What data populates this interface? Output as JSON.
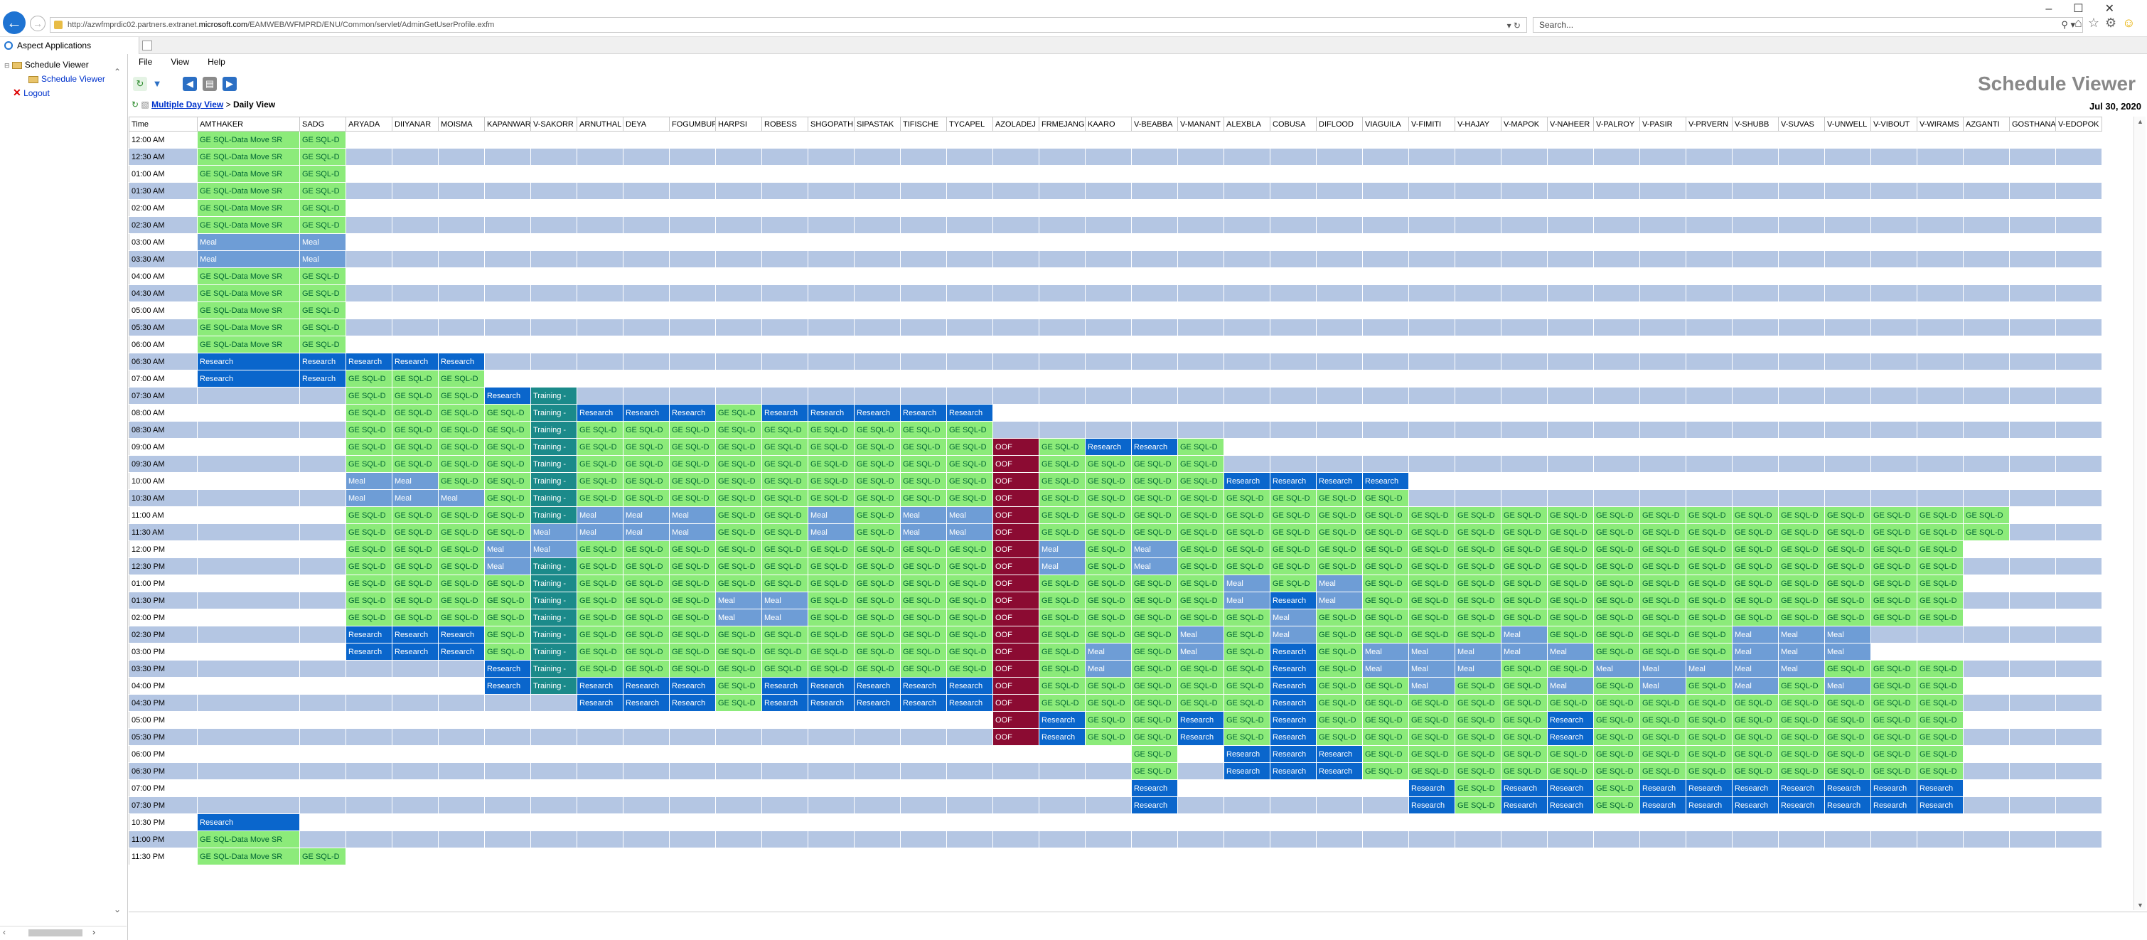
{
  "browser": {
    "url_prefix": "http://azwfmprdic02.partners.extranet.",
    "url_host": "microsoft.com",
    "url_path": "/EAMWEB/WFMPRD/ENU/Common/servlet/AdminGetUserProfile.exfm",
    "search_placeholder": "Search...",
    "tab_title": "Aspect Applications",
    "window_controls": "–☐✕"
  },
  "tree": {
    "root": "Schedule Viewer",
    "child": "Schedule Viewer",
    "logout": "Logout"
  },
  "menu": [
    "File",
    "View",
    "Help"
  ],
  "app_title": "Schedule Viewer",
  "nav": {
    "link": "Multiple Day View",
    "separator": ">",
    "current": "Daily View",
    "date": "Jul 30, 2020"
  },
  "legend_colors": {
    "G": "#8ceb7a",
    "R": "#0a66cc",
    "M": "#6e9dd6",
    "T": "#1b8a8a",
    "O": "#8b0b32"
  },
  "labels": {
    "G": "GE SQL-D",
    "GL": "GE SQL-Data Move SR",
    "R": "Research",
    "M": "Meal",
    "T": "Training -",
    "O": "OOF"
  },
  "schedule": {
    "time_header": "Time",
    "columns": [
      "AMTHAKER",
      "SADG",
      "ARYADA",
      "DIIYANAR",
      "MOISMA",
      "KAPANWAR",
      "V-SAKORR",
      "ARNUTHAL",
      "DEYA",
      "FOGUMBUR",
      "HARPSI",
      "ROBESS",
      "SHGOPATH",
      "SIPASTAK",
      "TIFISCHE",
      "TYCAPEL",
      "AZOLADEJ",
      "FRMEJANG",
      "KAARO",
      "V-BEABBA",
      "V-MANANT",
      "ALEXBLA",
      "COBUSA",
      "DIFLOOD",
      "VIAGUILA",
      "V-FIMITI",
      "V-HAJAY",
      "V-MAPOK",
      "V-NAHEER",
      "V-PALROY",
      "V-PASIR",
      "V-PRVERN",
      "V-SHUBB",
      "V-SUVAS",
      "V-UNWELL",
      "V-VIBOUT",
      "V-WIRAMS",
      "AZGANTI",
      "GOSTHANA",
      "V-EDOPOK"
    ],
    "rows": [
      [
        "12:00 AM",
        "L:0:1",
        "G:1:1"
      ],
      [
        "12:30 AM",
        "L:0:1",
        "G:1:1"
      ],
      [
        "01:00 AM",
        "L:0:1",
        "G:1:1"
      ],
      [
        "01:30 AM",
        "L:0:1",
        "G:1:1"
      ],
      [
        "02:00 AM",
        "L:0:1",
        "G:1:1"
      ],
      [
        "02:30 AM",
        "L:0:1",
        "G:1:1"
      ],
      [
        "03:00 AM",
        "M:0:1",
        "M:1:1"
      ],
      [
        "03:30 AM",
        "M:0:1",
        "M:1:1"
      ],
      [
        "04:00 AM",
        "L:0:1",
        "G:1:1"
      ],
      [
        "04:30 AM",
        "L:0:1",
        "G:1:1"
      ],
      [
        "05:00 AM",
        "L:0:1",
        "G:1:1"
      ],
      [
        "05:30 AM",
        "L:0:1",
        "G:1:1"
      ],
      [
        "06:00 AM",
        "L:0:1",
        "G:1:1"
      ],
      [
        "06:30 AM",
        "R:0:1",
        "R:1:1",
        "R:2:3"
      ],
      [
        "07:00 AM",
        "R:0:1",
        "R:1:1",
        "G:2:3"
      ],
      [
        "07:30 AM",
        "G:2:3",
        "R:5:1",
        "T:6:1"
      ],
      [
        "08:00 AM",
        "G:2:4",
        "T:6:1",
        "R:7:3",
        "G:10:1",
        "R:11:5"
      ],
      [
        "08:30 AM",
        "G:2:4",
        "T:6:1",
        "G:7:9"
      ],
      [
        "09:00 AM",
        "G:2:4",
        "T:6:1",
        "G:7:9",
        "O:16:1",
        "G:17:1",
        "R:18:2",
        "G:20:1"
      ],
      [
        "09:30 AM",
        "G:2:4",
        "T:6:1",
        "G:7:9",
        "O:16:1",
        "G:17:4"
      ],
      [
        "10:00 AM",
        "M:2:2",
        "G:4:2",
        "T:6:1",
        "G:7:9",
        "O:16:1",
        "G:17:4",
        "R:21:4"
      ],
      [
        "10:30 AM",
        "M:2:3",
        "G:5:1",
        "T:6:1",
        "G:7:9",
        "O:16:1",
        "G:17:8"
      ],
      [
        "11:00 AM",
        "G:2:4",
        "T:6:1",
        "M:7:3",
        "G:10:2",
        "M:12:1",
        "G:13:1",
        "M:14:2",
        "O:16:1",
        "G:17:21"
      ],
      [
        "11:30 AM",
        "G:2:4",
        "M:6:1",
        "M:7:3",
        "G:10:2",
        "M:12:1",
        "G:13:1",
        "M:14:2",
        "O:16:1",
        "G:17:21"
      ],
      [
        "12:00 PM",
        "G:2:3",
        "M:5:2",
        "G:7:9",
        "O:16:1",
        "M:17:1",
        "G:18:1",
        "M:19:1",
        "G:20:17"
      ],
      [
        "12:30 PM",
        "G:2:3",
        "M:5:1",
        "T:6:1",
        "G:7:9",
        "O:16:1",
        "M:17:1",
        "G:18:1",
        "M:19:1",
        "G:20:17"
      ],
      [
        "01:00 PM",
        "G:2:4",
        "T:6:1",
        "G:7:9",
        "O:16:1",
        "G:17:4",
        "M:21:1",
        "G:22:1",
        "M:23:1",
        "G:24:13"
      ],
      [
        "01:30 PM",
        "G:2:4",
        "T:6:1",
        "G:7:3",
        "M:10:2",
        "G:12:4",
        "O:16:1",
        "G:17:4",
        "M:21:1",
        "R:22:1",
        "M:23:1",
        "G:24:13"
      ],
      [
        "02:00 PM",
        "G:2:4",
        "T:6:1",
        "G:7:3",
        "M:10:2",
        "G:12:4",
        "O:16:1",
        "G:17:5",
        "M:22:1",
        "G:23:14"
      ],
      [
        "02:30 PM",
        "R:2:3",
        "G:5:1",
        "T:6:1",
        "G:7:9",
        "O:16:1",
        "G:17:3",
        "M:20:1",
        "G:21:1",
        "M:22:1",
        "G:23:4",
        "M:27:1",
        "G:28:4",
        "M:32:3"
      ],
      [
        "03:00 PM",
        "R:2:3",
        "G:5:1",
        "T:6:1",
        "G:7:9",
        "O:16:1",
        "G:17:1",
        "M:18:1",
        "G:19:1",
        "M:20:1",
        "G:21:1",
        "R:22:1",
        "G:23:1",
        "M:24:5",
        "G:29:3",
        "M:32:3"
      ],
      [
        "03:30 PM",
        "R:5:1",
        "T:6:1",
        "G:7:9",
        "O:16:1",
        "G:17:1",
        "M:18:1",
        "G:19:3",
        "R:22:1",
        "G:23:1",
        "M:24:3",
        "G:27:2",
        "M:29:5",
        "G:34:3"
      ],
      [
        "04:00 PM",
        "R:5:1",
        "T:6:1",
        "R:7:3",
        "G:10:1",
        "R:11:5",
        "O:16:1",
        "G:17:5",
        "R:22:1",
        "G:23:2",
        "M:25:1",
        "G:26:2",
        "M:28:1",
        "G:29:1",
        "M:30:1",
        "G:31:1",
        "M:32:1",
        "G:33:1",
        "M:34:1",
        "G:35:2"
      ],
      [
        "04:30 PM",
        "R:7:3",
        "G:10:1",
        "R:11:5",
        "O:16:1",
        "G:17:5",
        "R:22:1",
        "G:23:14"
      ],
      [
        "05:00 PM",
        "O:16:1",
        "R:17:1",
        "G:18:2",
        "R:20:1",
        "G:21:1",
        "R:22:1",
        "G:23:5",
        "R:28:1",
        "G:29:8"
      ],
      [
        "05:30 PM",
        "O:16:1",
        "R:17:1",
        "G:18:2",
        "R:20:1",
        "G:21:1",
        "R:22:1",
        "G:23:5",
        "R:28:1",
        "G:29:8"
      ],
      [
        "06:00 PM",
        "G:19:1",
        "R:21:3",
        "G:24:13"
      ],
      [
        "06:30 PM",
        "G:19:1",
        "R:21:3",
        "G:24:13"
      ],
      [
        "07:00 PM",
        "R:19:1",
        "R:25:1",
        "G:26:1",
        "R:27:2",
        "G:29:1",
        "R:30:7"
      ],
      [
        "07:30 PM",
        "R:19:1",
        "R:25:1",
        "G:26:1",
        "R:27:2",
        "G:29:1",
        "R:30:7"
      ],
      [
        "10:30 PM",
        "R:0:1"
      ],
      [
        "11:00 PM",
        "L:0:1"
      ],
      [
        "11:30 PM",
        "L:0:1",
        "G:1:1"
      ]
    ]
  }
}
